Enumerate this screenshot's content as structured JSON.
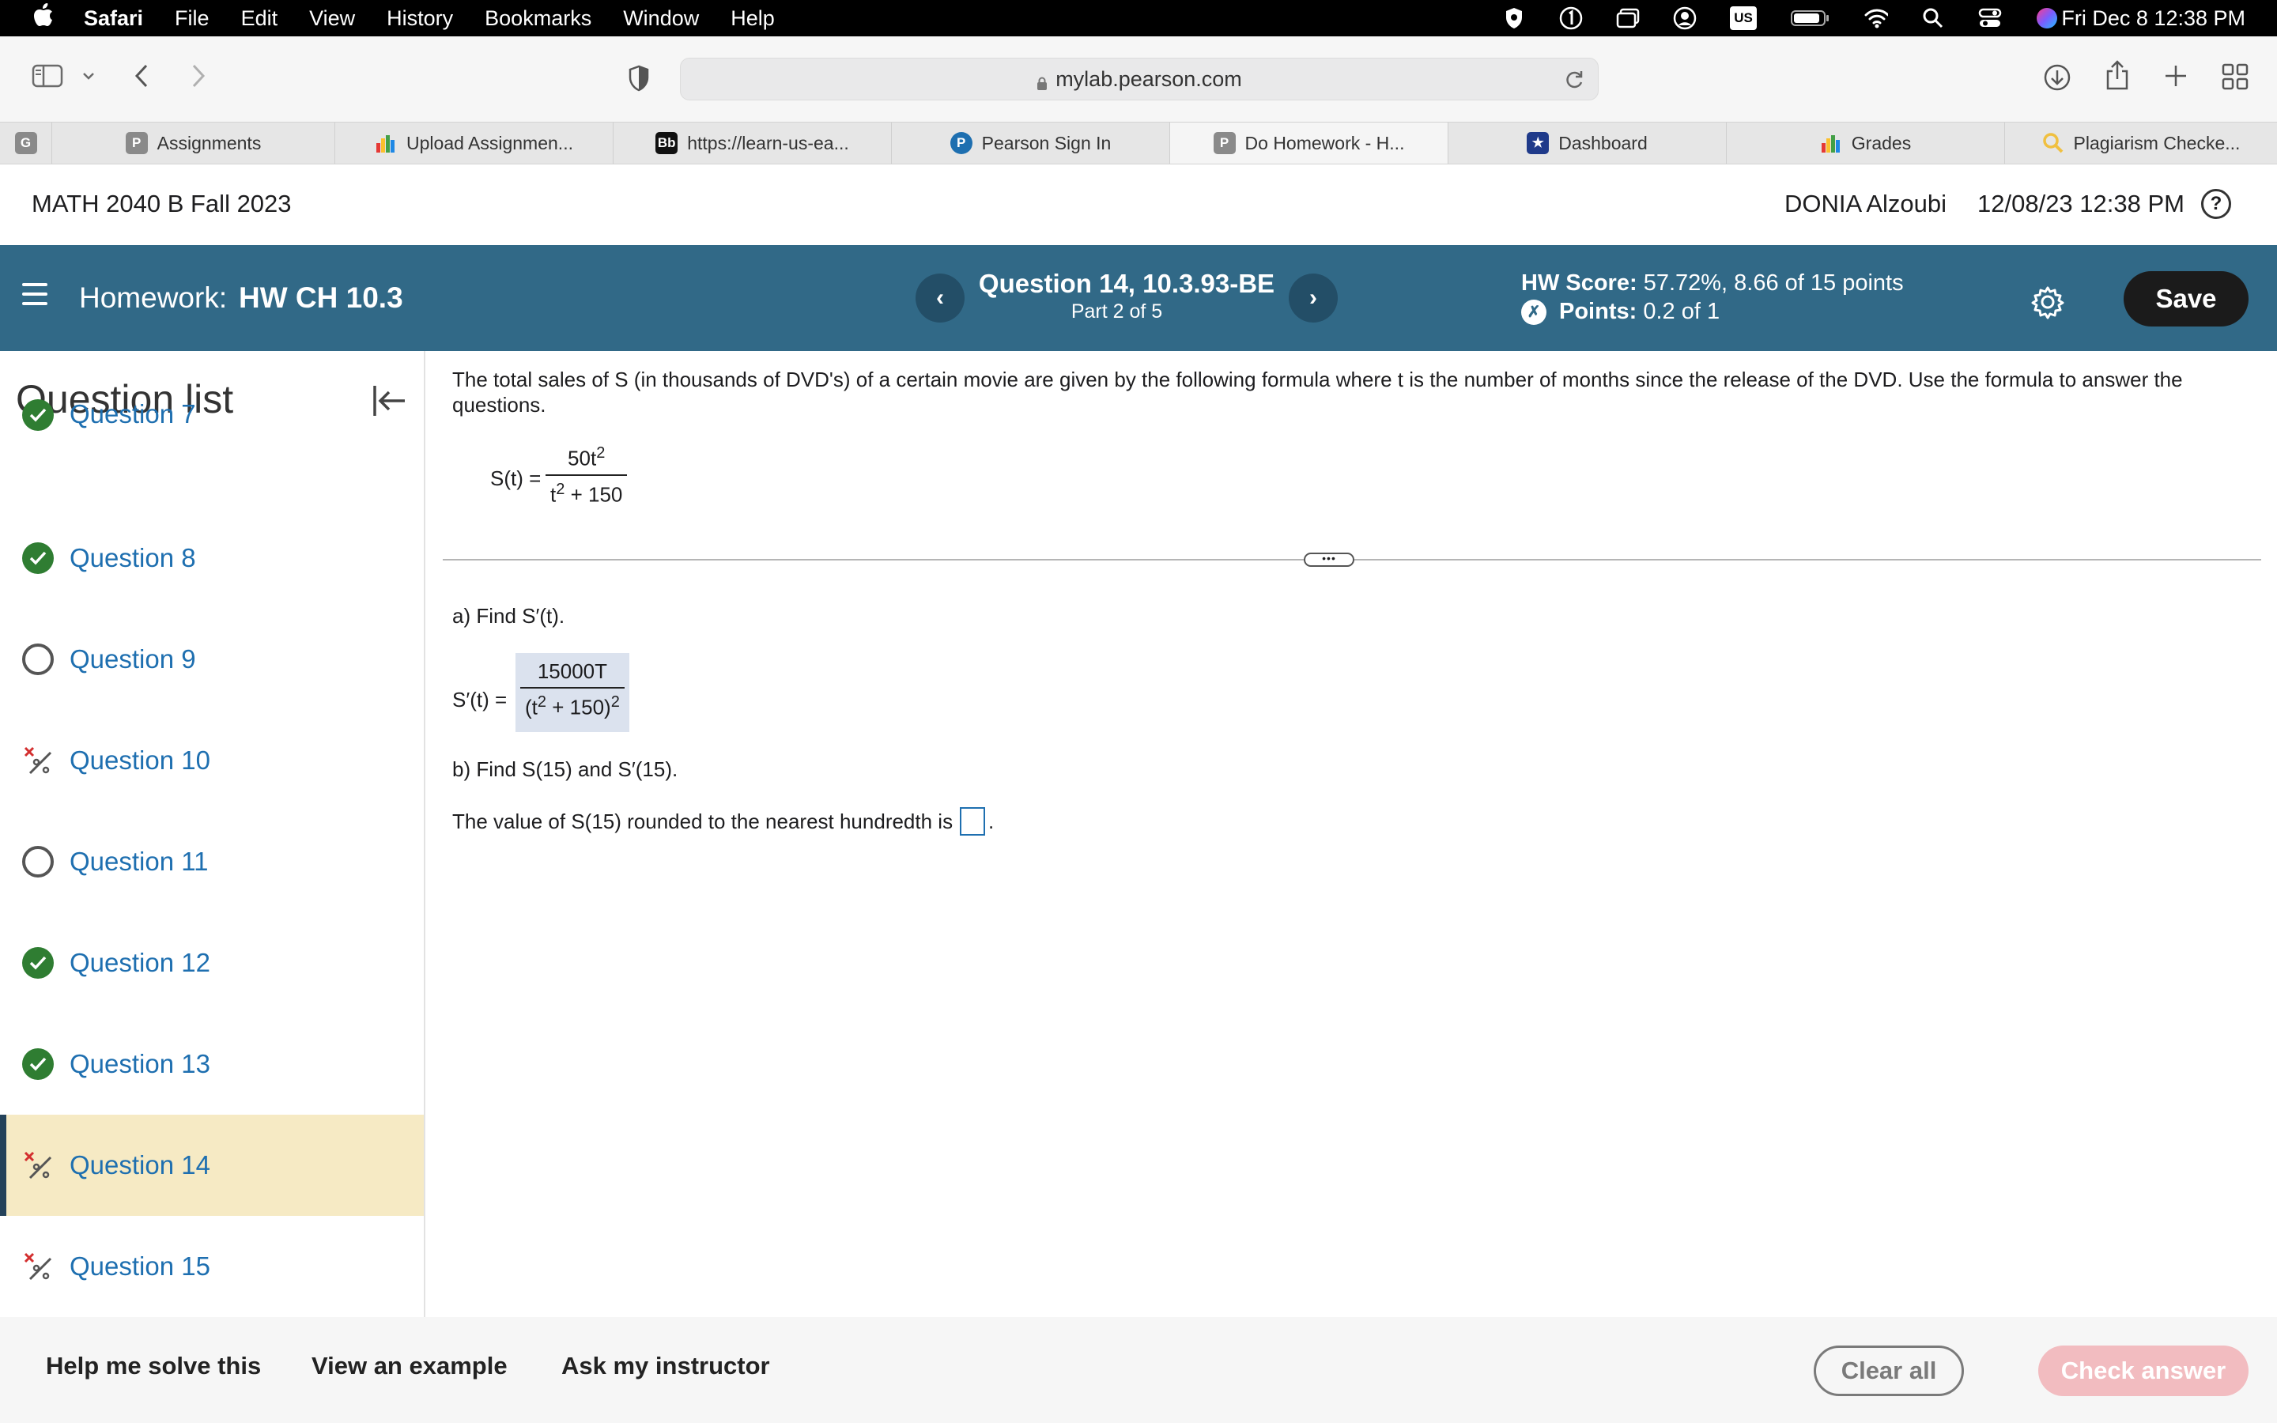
{
  "menubar": {
    "apple": "",
    "items": [
      "Safari",
      "File",
      "Edit",
      "View",
      "History",
      "Bookmarks",
      "Window",
      "Help"
    ],
    "status_icons": [
      "shield-icon",
      "one-icon",
      "window-icon",
      "user-circle-icon",
      "keyboard-flag-icon",
      "battery-icon",
      "wifi-icon",
      "search-icon",
      "control-center-icon",
      "siri-icon"
    ],
    "keyboard_label": "US",
    "clock": "Fri Dec 8  12:38 PM"
  },
  "browser": {
    "url": "mylab.pearson.com",
    "tabs": [
      {
        "label": "",
        "fav": "G",
        "color": "#8a8a8a"
      },
      {
        "label": "Assignments",
        "fav": "P",
        "color": "#8a8a8a"
      },
      {
        "label": "Upload Assignmen...",
        "fav": "chart",
        "color": "#1a1a1a"
      },
      {
        "label": "https://learn-us-ea...",
        "fav": "Bb",
        "color": "#111111"
      },
      {
        "label": "Pearson Sign In",
        "fav": "P",
        "color": "#1e6fb0"
      },
      {
        "label": "Do Homework - H...",
        "fav": "P",
        "color": "#8a8a8a"
      },
      {
        "label": "Dashboard",
        "fav": "★",
        "color": "#1f3a8a"
      },
      {
        "label": "Grades",
        "fav": "chart",
        "color": "#1a1a1a"
      },
      {
        "label": "Plagiarism Checke...",
        "fav": "🔍",
        "color": "#f0c040"
      }
    ]
  },
  "course": {
    "title": "MATH 2040 B Fall 2023",
    "user": "DONIA Alzoubi",
    "datetime": "12/08/23 12:38 PM",
    "help": "?"
  },
  "hw": {
    "label": "Homework:",
    "name": "HW CH 10.3",
    "question_title": "Question 14, 10.3.93-BE",
    "part": "Part 2 of 5",
    "score_label": "HW Score:",
    "score_value": "57.72%, 8.66 of 15 points",
    "points_label": "Points:",
    "points_value": "0.2 of 1",
    "save": "Save",
    "prev": "‹",
    "next": "›"
  },
  "sidebar": {
    "title": "Question list",
    "questions": [
      {
        "label": "Question 7",
        "status": "done"
      },
      {
        "label": "Question 8",
        "status": "done"
      },
      {
        "label": "Question 9",
        "status": "open"
      },
      {
        "label": "Question 10",
        "status": "partial"
      },
      {
        "label": "Question 11",
        "status": "open"
      },
      {
        "label": "Question 12",
        "status": "done"
      },
      {
        "label": "Question 13",
        "status": "done"
      },
      {
        "label": "Question 14",
        "status": "partial",
        "active": true
      },
      {
        "label": "Question 15",
        "status": "partial"
      }
    ]
  },
  "question": {
    "intro": "The total sales of S (in thousands of DVD's) of a certain movie are given by the following formula where t is the number of months since the release of the DVD. Use the formula to answer the questions.",
    "formula_lhs": "S(t) =",
    "formula_num": "50t",
    "formula_den_a": "t",
    "formula_den_b": "+ 150",
    "exp": "2",
    "part_a": "a) Find S′(t).",
    "answer_lhs": "S′(t) =",
    "answer_num": "15000T",
    "answer_den_open": "(t",
    "answer_den_mid": "+ 150)",
    "part_b": "b) Find S(15) and S′(15).",
    "prompt": "The value of S(15) rounded to the nearest hundredth is",
    "prompt_end": ".",
    "divider_handle": "•••"
  },
  "footer": {
    "help_solve": "Help me solve this",
    "example": "View an example",
    "instructor": "Ask my instructor",
    "clear": "Clear all",
    "check": "Check answer"
  }
}
